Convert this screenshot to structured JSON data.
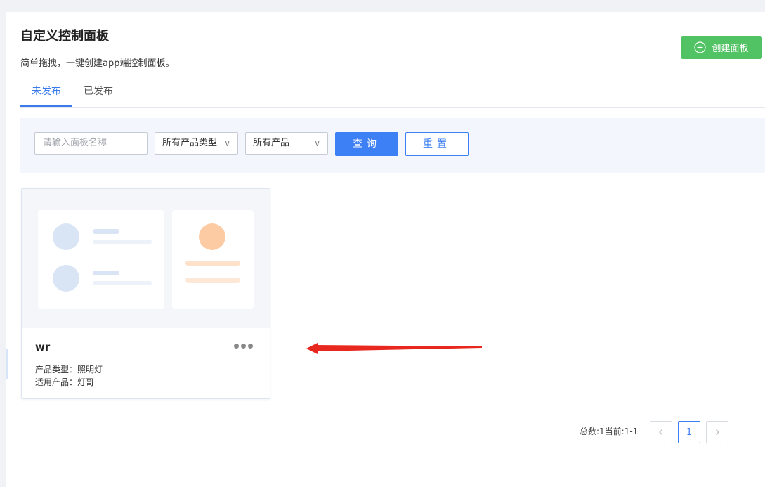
{
  "header": {
    "title": "自定义控制面板",
    "subtitle": "简单拖拽，一键创建app端控制面板。",
    "create_button": "创建面板"
  },
  "tabs": [
    {
      "label": "未发布",
      "active": true
    },
    {
      "label": "已发布",
      "active": false
    }
  ],
  "filters": {
    "name_placeholder": "请输入面板名称",
    "product_type": "所有产品类型",
    "product": "所有产品",
    "query_label": "查询",
    "reset_label": "重置"
  },
  "cards": [
    {
      "name": "wr",
      "product_type": "产品类型：照明灯",
      "applicable_product": "适用产品：灯哥"
    }
  ],
  "pagination": {
    "summary": "总数:1当前:1-1",
    "current_page": "1",
    "prev_icon": "chevron-left-icon",
    "next_icon": "chevron-right-icon"
  },
  "colors": {
    "accent": "#3d7ff4",
    "create": "#52c364",
    "annotation_arrow": "#e8281e"
  }
}
